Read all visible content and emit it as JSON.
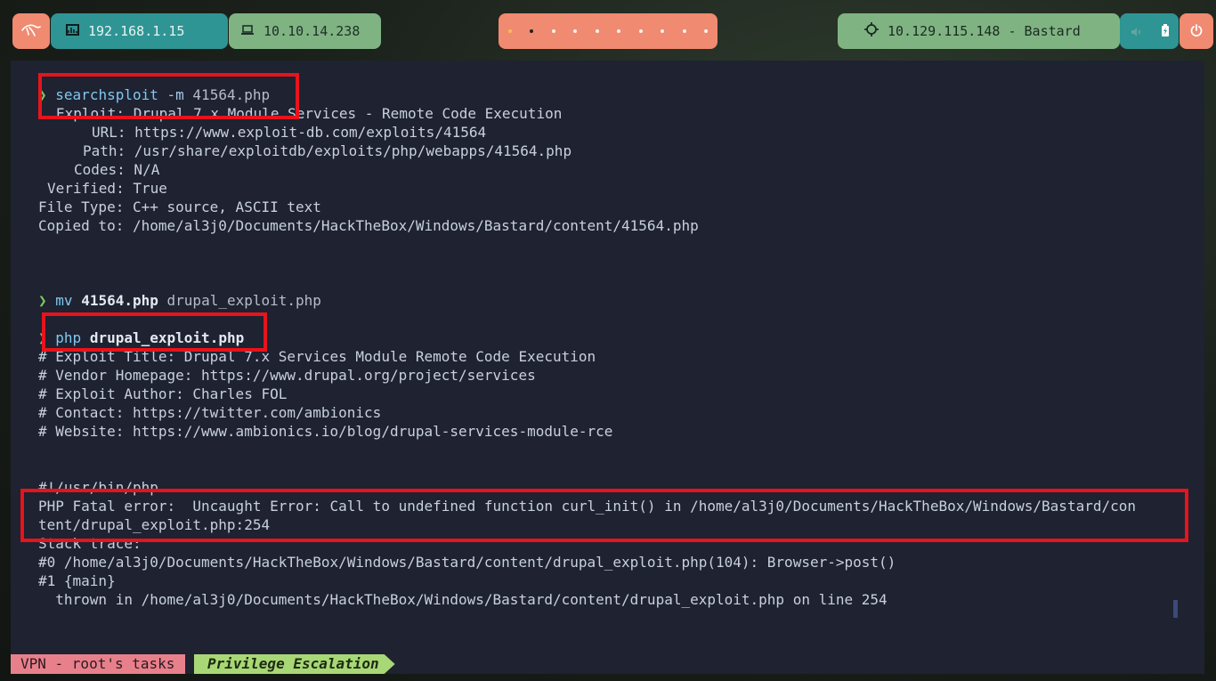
{
  "topbar": {
    "host_ip": "192.168.1.15",
    "vpn_ip": "10.10.14.238",
    "target": "10.129.115.148 - Bastard",
    "workspaces_count": 10,
    "active_workspace": 2
  },
  "terminal": {
    "searchsploit": {
      "cmd": "searchsploit",
      "flag": "-m",
      "arg": "41564.php",
      "exploit": "Exploit: Drupal 7.x Module Services - Remote Code Execution",
      "url": "URL: https://www.exploit-db.com/exploits/41564",
      "path": "Path: /usr/share/exploitdb/exploits/php/webapps/41564.php",
      "codes": "Codes: N/A",
      "verified": "Verified: True",
      "file_type": "File Type: C++ source, ASCII text",
      "copied_to": "Copied to: /home/al3j0/Documents/HackTheBox/Windows/Bastard/content/41564.php"
    },
    "mv": {
      "cmd": "mv",
      "src": "41564.php",
      "dst": "drupal_exploit.php"
    },
    "php": {
      "cmd": "php",
      "arg": "drupal_exploit.php",
      "out1": "# Exploit Title: Drupal 7.x Services Module Remote Code Execution",
      "out2": "# Vendor Homepage: https://www.drupal.org/project/services",
      "out3": "# Exploit Author: Charles FOL",
      "out4": "# Contact: https://twitter.com/ambionics",
      "out5": "# Website: https://www.ambionics.io/blog/drupal-services-module-rce",
      "shebang": "#!/usr/bin/php",
      "error1": "PHP Fatal error:  Uncaught Error: Call to undefined function curl_init() in /home/al3j0/Documents/HackTheBox/Windows/Bastard/con",
      "error2": "tent/drupal_exploit.php:254",
      "trace": "Stack trace:",
      "trace0": "#0 /home/al3j0/Documents/HackTheBox/Windows/Bastard/content/drupal_exploit.php(104): Browser->post()",
      "trace1": "#1 {main}",
      "thrown": "  thrown in /home/al3j0/Documents/HackTheBox/Windows/Bastard/content/drupal_exploit.php on line 254"
    },
    "prompt_symbol": "❯"
  },
  "statusbar": {
    "session": "VPN - root's tasks",
    "active_tab": "Privilege Escalation"
  },
  "colors": {
    "highlight_box": "#e8131b",
    "terminal_bg": "#1e2231",
    "prompt": "#7ec85a",
    "command": "#7fc8f0"
  },
  "icons": {
    "menu": "kali-dragon-icon",
    "host": "network-icon",
    "vpn": "laptop-icon",
    "target": "crosshair-icon",
    "power": "power-icon"
  }
}
